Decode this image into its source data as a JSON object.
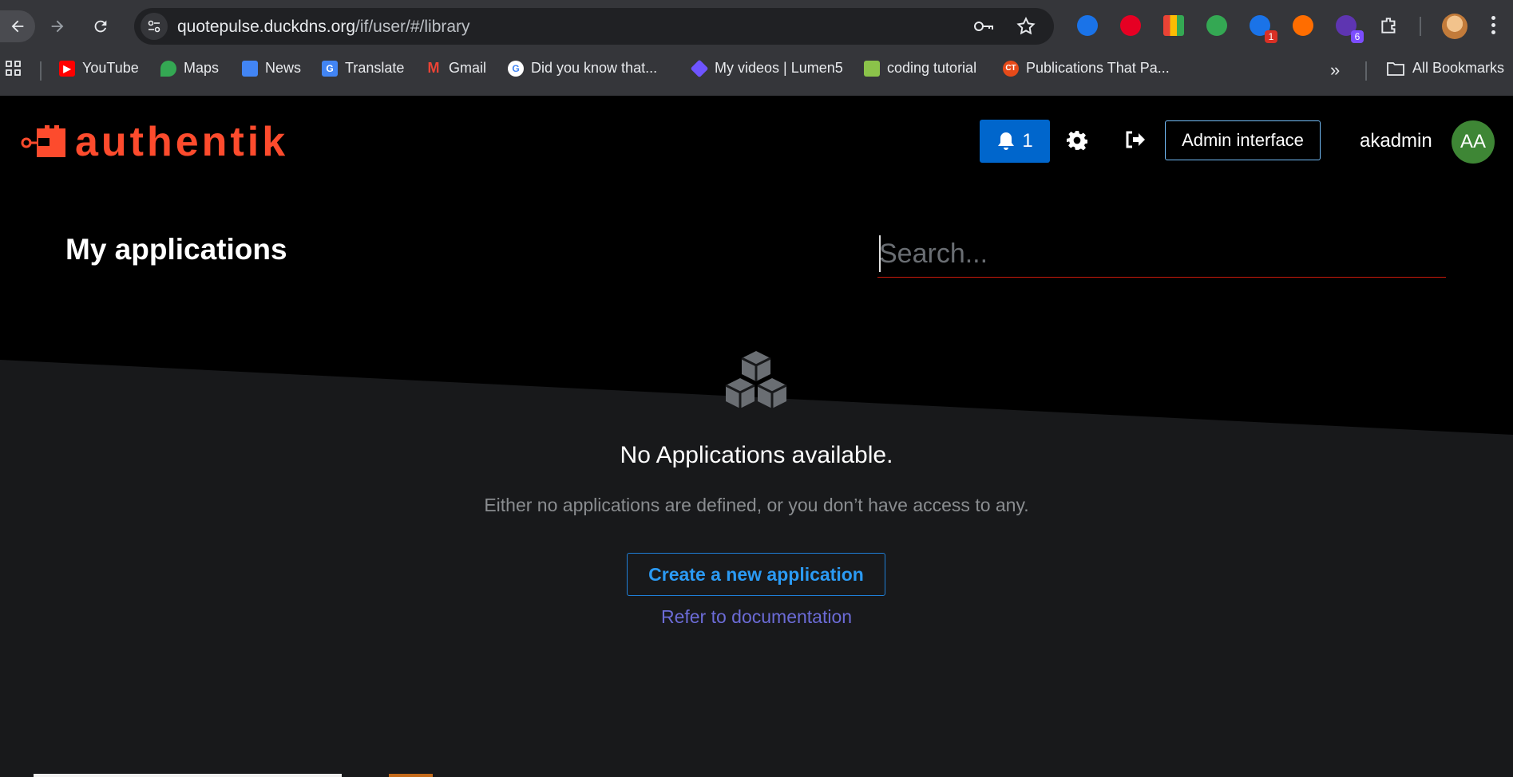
{
  "browser": {
    "url_host": "quotepulse.duckdns.org",
    "url_path": "/if/user/#/library",
    "bookmarks": [
      {
        "label": "YouTube",
        "icon": "youtube-icon",
        "color": "#ff0000"
      },
      {
        "label": "Maps",
        "icon": "maps-icon",
        "color": "#34a853"
      },
      {
        "label": "News",
        "icon": "news-icon",
        "color": "#4285f4"
      },
      {
        "label": "Translate",
        "icon": "translate-icon",
        "color": "#4285f4"
      },
      {
        "label": "Gmail",
        "icon": "gmail-icon",
        "color": "#ea4335"
      },
      {
        "label": "Did you know that...",
        "icon": "google-icon",
        "color": "#ffffff"
      },
      {
        "label": "My videos | Lumen5",
        "icon": "lumen5-icon",
        "color": "#6e54ff"
      },
      {
        "label": "coding tutorial",
        "icon": "coding-tutorial-icon",
        "color": "#8bc34a"
      },
      {
        "label": "Publications That Pa...",
        "icon": "ct-icon",
        "color": "#e64a19"
      }
    ],
    "all_bookmarks_label": "All Bookmarks",
    "extension_badges": [
      "1",
      "6"
    ],
    "bookmark_icon_letters": {
      "ct": "CT"
    }
  },
  "app": {
    "brand": "authentik",
    "brand_color": "#fd4b2d",
    "notifications_count": "1",
    "admin_button_label": "Admin interface",
    "username": "akadmin",
    "avatar_initials": "AA",
    "page_title": "My applications",
    "search_placeholder": "Search...",
    "empty_state": {
      "title": "No Applications available.",
      "body": "Either no applications are defined, or you don’t have access to any.",
      "create_button": "Create a new application",
      "docs_link": "Refer to documentation"
    }
  }
}
